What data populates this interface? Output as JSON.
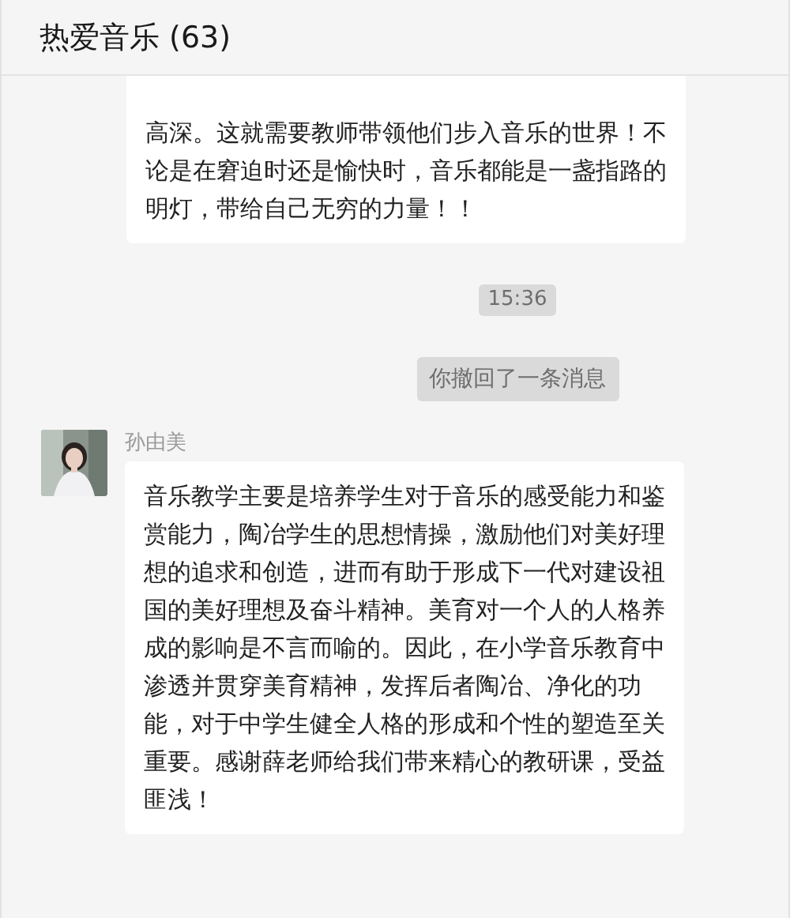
{
  "window": {
    "title": "热爱音乐 (63)"
  },
  "messages": [
    {
      "kind": "bubble",
      "text": "高深。这就需要教师带领他们步入音乐的世界！不论是在窘迫时还是愉快时，音乐都能是一盏指路的明灯，带给自己无穷的力量！！"
    },
    {
      "kind": "time",
      "text": "15:36"
    },
    {
      "kind": "notice",
      "text": "你撤回了一条消息"
    },
    {
      "kind": "incoming",
      "sender": "孙由美",
      "text": "音乐教学主要是培养学生对于音乐的感受能力和鉴赏能力，陶冶学生的思想情操，激励他们对美好理想的追求和创造，进而有助于形成下一代对建设祖国的美好理想及奋斗精神。美育对一个人的人格养成的影响是不言而喻的。因此，在小学音乐教育中渗透并贯穿美育精神，发挥后者陶冶、净化的功能，对于中学生健全人格的形成和个性的塑造至关重要。感谢薛老师给我们带来精心的教研课，受益匪浅！"
    }
  ]
}
